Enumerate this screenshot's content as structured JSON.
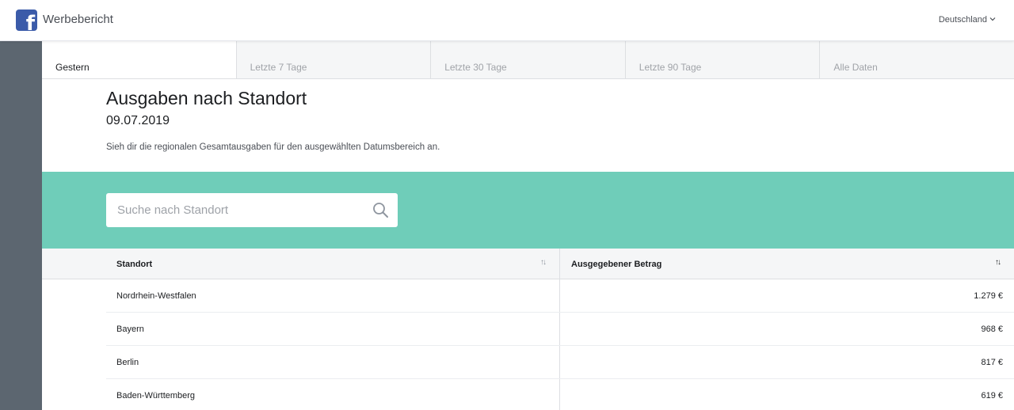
{
  "header": {
    "app_title": "Werbebericht",
    "country_selector": "Deutschland",
    "brand_color": "#3b5ba9"
  },
  "tabs": [
    {
      "label": "Gestern",
      "active": true
    },
    {
      "label": "Letzte 7 Tage",
      "active": false
    },
    {
      "label": "Letzte 30 Tage",
      "active": false
    },
    {
      "label": "Letzte 90 Tage",
      "active": false
    },
    {
      "label": "Alle Daten",
      "active": false
    }
  ],
  "report": {
    "title": "Ausgaben nach Standort",
    "date": "09.07.2019",
    "description": "Sieh dir die regionalen Gesamtausgaben für den ausgewählten Datumsbereich an."
  },
  "search": {
    "placeholder": "Suche nach Standort",
    "value": "",
    "band_color": "#6fcdb9"
  },
  "table": {
    "columns": [
      "Standort",
      "Ausgegebener Betrag"
    ],
    "rows": [
      {
        "location": "Nordrhein-Westfalen",
        "amount": "1.279 €"
      },
      {
        "location": "Bayern",
        "amount": "968 €"
      },
      {
        "location": "Berlin",
        "amount": "817 €"
      },
      {
        "location": "Baden-Württemberg",
        "amount": "619 €"
      }
    ]
  }
}
